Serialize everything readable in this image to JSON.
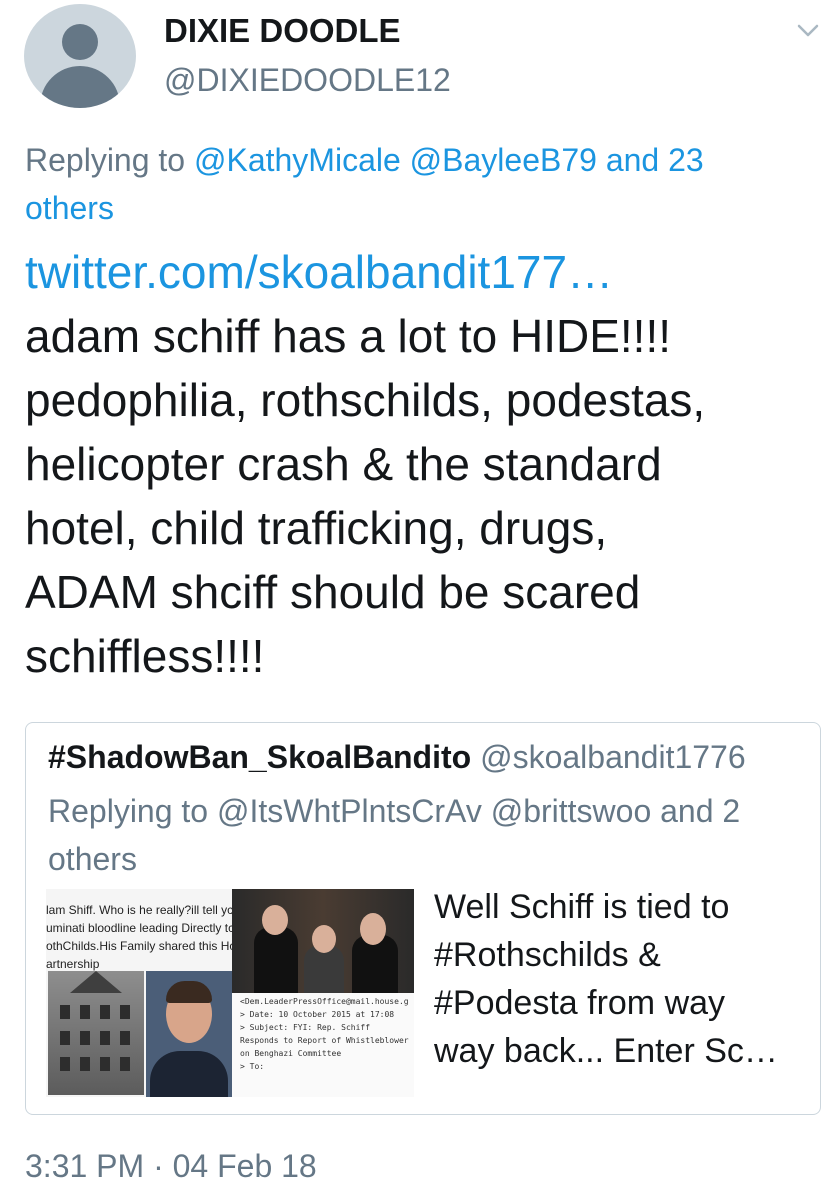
{
  "author": {
    "display_name": "DIXIE DOODLE",
    "handle": "@DIXIEDOODLE12"
  },
  "reply_context": {
    "prefix": "Replying to",
    "mentions": "@KathyMicale @BayleeB79 and 23 others"
  },
  "tweet": {
    "link": "twitter.com/skoalbandit177…",
    "lines": [
      "adam schiff has a lot to HIDE!!!!",
      "pedophilia, rothschilds, podestas,",
      "helicopter crash & the standard",
      "hotel, child trafficking, drugs,",
      "ADAM shciff should be scared",
      "schiffless!!!!"
    ]
  },
  "quoted_tweet": {
    "display_name": "#ShadowBan_SkoalBandito",
    "handle": "@skoalbandit1776",
    "reply_prefix": "Replying to",
    "reply_mentions": "@ItsWhtPlntsCrAv @brittswoo and 2 others",
    "media1_text": [
      "lam Shiff. Who is he really?ill tell yc",
      "uminati bloodline leading Directly tc",
      "othChilds.His Family shared this Hc",
      "artnership"
    ],
    "media2_email": [
      "<Dem.LeaderPressOffice@mail.house.g",
      "",
      "> Date: 10 October 2015 at 17:08",
      "> Subject: FYI: Rep. Schiff",
      "Responds to Report of Whistleblower",
      "on Benghazi Committee",
      "> To:"
    ],
    "text_lines": [
      "Well Schiff is tied to",
      "#Rothschilds &",
      "#Podesta from way",
      "way back...  Enter Sc…"
    ]
  },
  "timestamp": "3:31 PM · 04 Feb 18",
  "icons": {
    "menu": "chevron-down-icon",
    "avatar": "default-avatar-icon"
  },
  "colors": {
    "link": "#1b95e0",
    "secondary_text": "#657786",
    "primary_text": "#14171a",
    "border": "#ccd6dd"
  }
}
